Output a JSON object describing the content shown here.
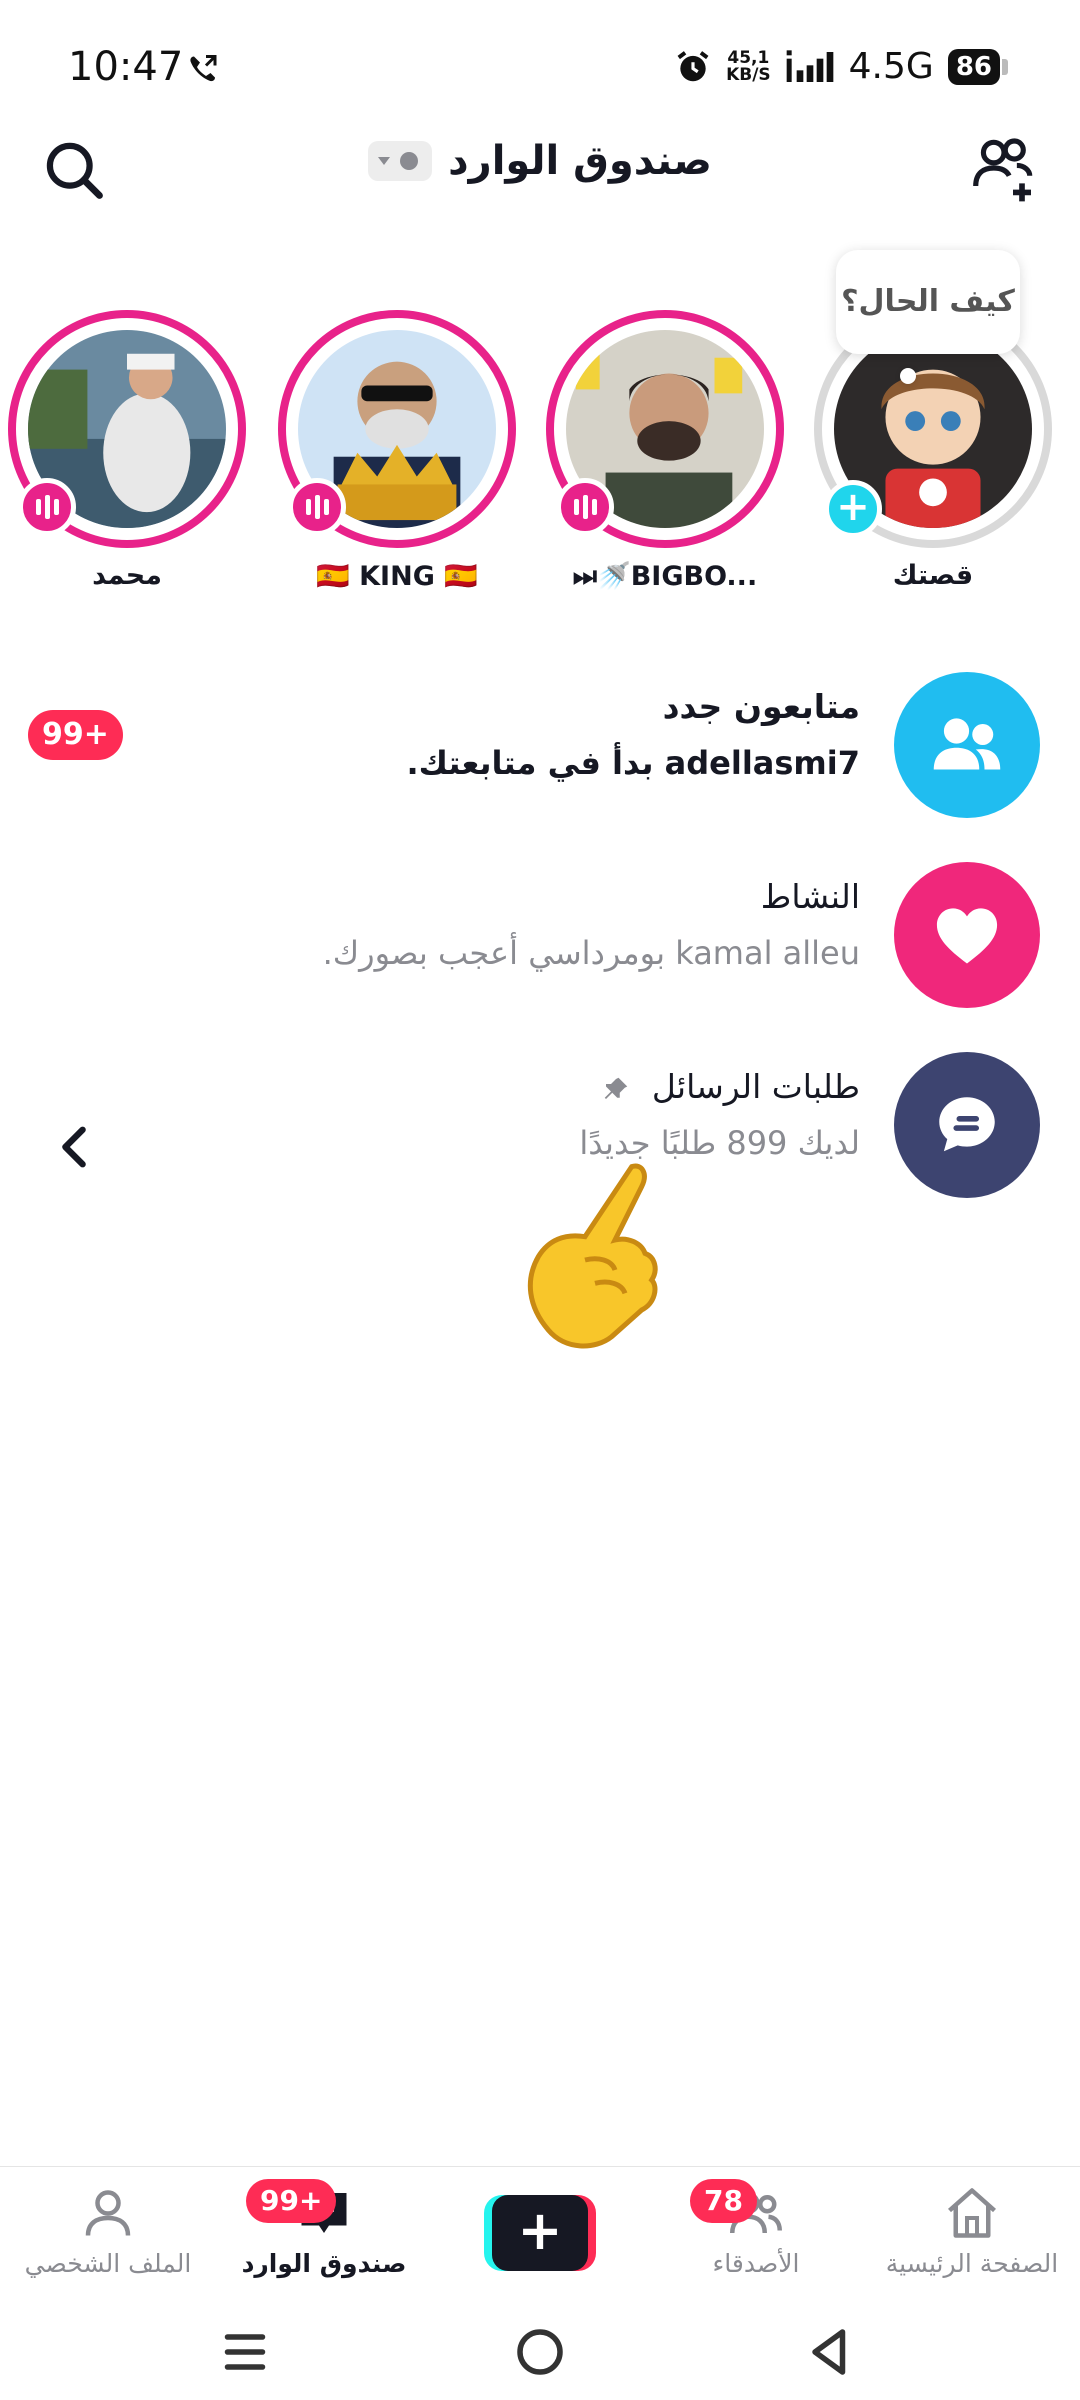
{
  "status_bar": {
    "time": "10:47",
    "net_speed_value": "45,1",
    "net_speed_unit": "KB/S",
    "network_type": "4.5G",
    "battery": "86"
  },
  "header": {
    "title": "صندوق الوارد"
  },
  "stories": {
    "bubble_text": "كيف الحال؟",
    "items": [
      {
        "label": "قصتك"
      },
      {
        "label": "BIGBO..."
      },
      {
        "label": "🇪🇸 KING 🇪🇸"
      },
      {
        "label": "محمد"
      }
    ]
  },
  "inbox": {
    "new_followers": {
      "title": "متابعون جدد",
      "subtitle": "adellasmi7 بدأ في متابعتك.",
      "badge": "99+"
    },
    "activity": {
      "title": "النشاط",
      "subtitle": "kamal alleu بومرداسي أعجب بصورك."
    },
    "message_requests": {
      "title": "طلبات الرسائل",
      "subtitle": "لديك 899 طلبًا جديدًا"
    }
  },
  "bottom_nav": {
    "home": "الصفحة الرئيسية",
    "friends": "الأصدقاء",
    "friends_badge": "78",
    "inbox": "صندوق الوارد",
    "inbox_badge": "99+",
    "profile": "الملف الشخصي"
  },
  "colors": {
    "accent_pink": "#e8228a",
    "badge_red": "#fe2c55",
    "followers_icon_bg": "#20bdf0",
    "activity_icon_bg": "#f0277b",
    "requests_icon_bg": "#3d4470"
  }
}
